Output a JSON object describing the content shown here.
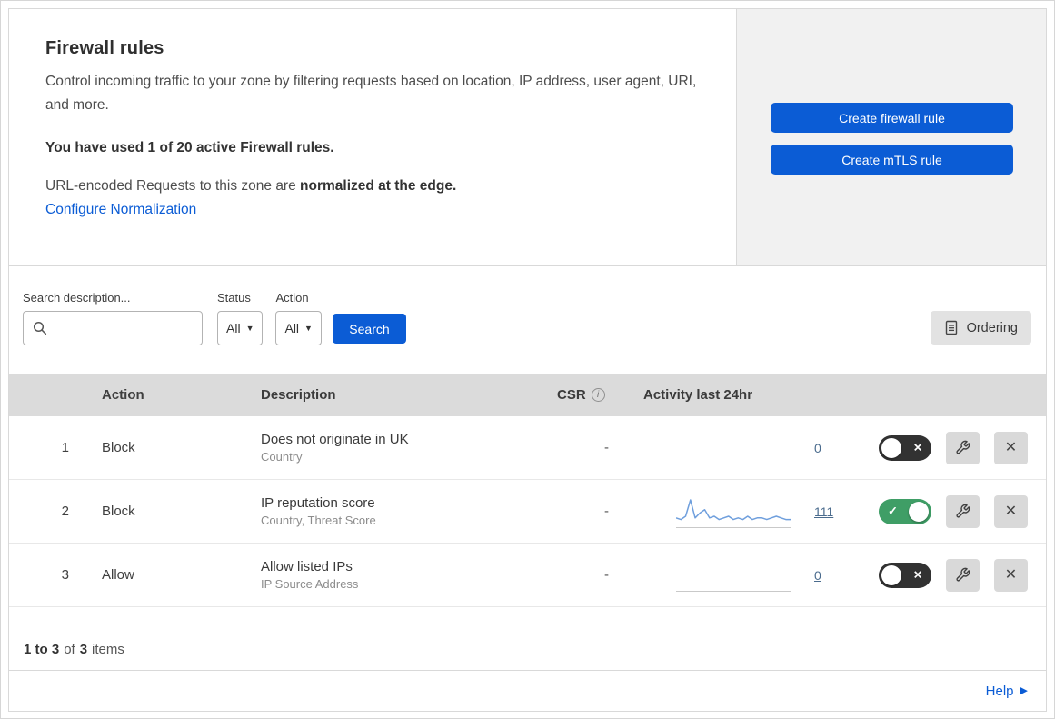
{
  "header": {
    "title": "Firewall rules",
    "description": "Control incoming traffic to your zone by filtering requests based on location, IP address, user agent, URI, and more.",
    "usage_note": "You have used 1 of 20 active Firewall rules.",
    "normalization_text": "URL-encoded Requests to this zone are ",
    "normalization_bold": "normalized at the edge.",
    "normalization_link": "Configure Normalization",
    "create_firewall_button": "Create firewall rule",
    "create_mtls_button": "Create mTLS rule"
  },
  "filters": {
    "search_label": "Search description...",
    "status_label": "Status",
    "status_value": "All",
    "action_label": "Action",
    "action_value": "All",
    "search_button": "Search",
    "ordering_button": "Ordering"
  },
  "table": {
    "headers": {
      "action": "Action",
      "description": "Description",
      "csr": "CSR",
      "activity": "Activity last 24hr"
    },
    "rows": [
      {
        "index": "1",
        "action": "Block",
        "title": "Does not originate in UK",
        "subtitle": "Country",
        "csr": "-",
        "activity_count": "0",
        "enabled": false,
        "sparkline": []
      },
      {
        "index": "2",
        "action": "Block",
        "title": "IP reputation score",
        "subtitle": "Country, Threat Score",
        "csr": "-",
        "activity_count": "111",
        "enabled": true,
        "sparkline": [
          4,
          3,
          5,
          15,
          4,
          7,
          9,
          4,
          5,
          3,
          4,
          5,
          3,
          4,
          3,
          5,
          3,
          4,
          4,
          3,
          4,
          5,
          4,
          3,
          3
        ]
      },
      {
        "index": "3",
        "action": "Allow",
        "title": "Allow listed IPs",
        "subtitle": "IP Source Address",
        "csr": "-",
        "activity_count": "0",
        "enabled": false,
        "sparkline": []
      }
    ]
  },
  "footer": {
    "range": "1 to 3",
    "of": "of",
    "total": "3",
    "items": "items"
  },
  "help": {
    "label": "Help"
  },
  "icons": {
    "dropdown_caret": "▼",
    "close": "✕",
    "info": "i",
    "help_arrow": "▶",
    "toggle_off": "✕",
    "toggle_on": "✓"
  },
  "colors": {
    "accent_blue": "#0b5cd5",
    "toggle_on_green": "#3f9e66",
    "toggle_off_dark": "#323232",
    "sparkline_blue": "#6f9fdd"
  }
}
